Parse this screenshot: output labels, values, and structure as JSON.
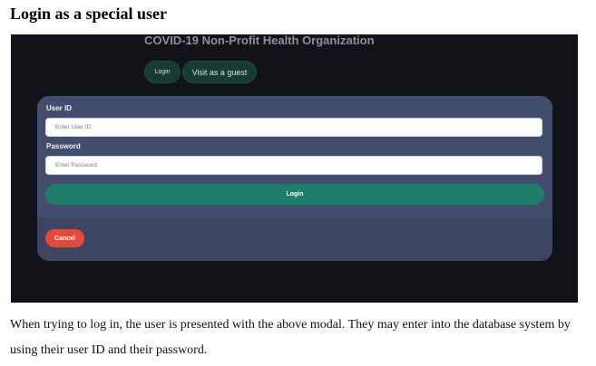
{
  "heading": "Login as a special user",
  "app": {
    "title": "COVID-19 Non-Profit Health Organization",
    "nav": {
      "login_label": "Login",
      "guest_label": "Visit as a guest"
    }
  },
  "modal": {
    "user_id": {
      "label": "User ID",
      "placeholder": "Enter User ID",
      "value": ""
    },
    "password": {
      "label": "Password",
      "placeholder": "Enter Password",
      "value": ""
    },
    "login_label": "Login",
    "cancel_label": "Cancel"
  },
  "caption": "When trying to log in, the user is presented with the above modal. They may enter into the database system by using their user ID and their password.",
  "colors": {
    "backdrop": "#111318",
    "modal_body": "#434d6e",
    "modal_footer": "#3d4560",
    "primary": "#1f7e69",
    "danger": "#e5493b",
    "nav_button": "#173b30"
  }
}
